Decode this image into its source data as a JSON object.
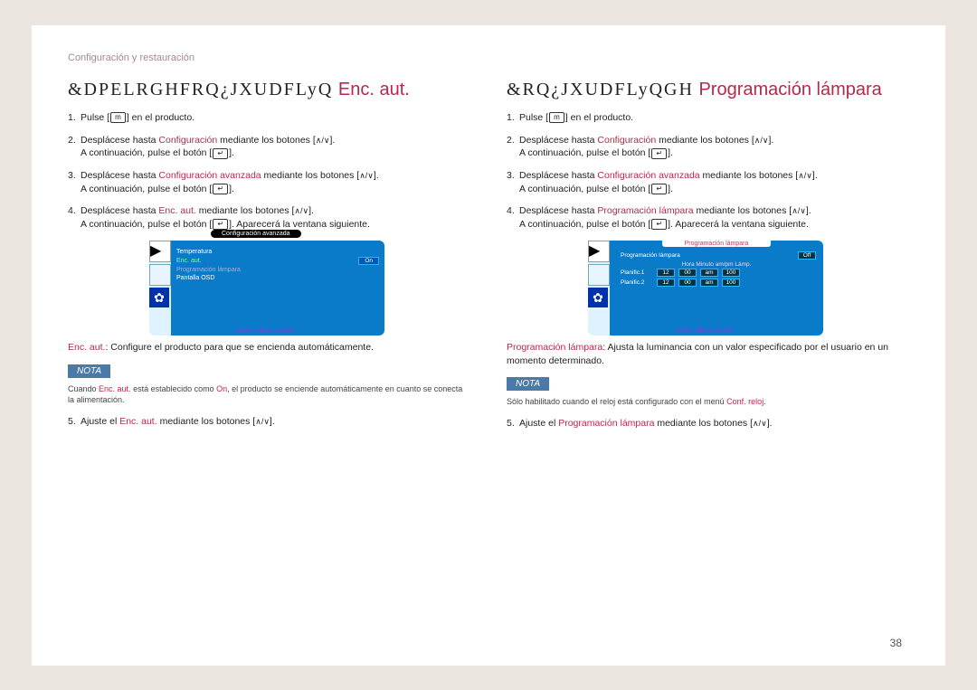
{
  "header": "Configuración y restauración",
  "pageNumber": "38",
  "left": {
    "title_garbled": "&DPELRGHFRQ¿JXUDFLyQ",
    "title_accent": "Enc. aut.",
    "steps": {
      "s1a": "Pulse [",
      "s1b": "] en el producto.",
      "s2a": "Desplácese hasta ",
      "s2b": "Configuración",
      "s2c": " mediante los botones [",
      "s2d": "].",
      "s2e": "A continuación, pulse el botón [",
      "s2f": "].",
      "s3a": "Desplácese hasta ",
      "s3b": "Configuración avanzada",
      "s3c": " mediante los botones [",
      "s3d": "].",
      "s3e": "A continuación, pulse el botón [",
      "s3f": "].",
      "s4a": "Desplácese hasta ",
      "s4b": "Enc. aut.",
      "s4c": " mediante los botones [",
      "s4d": "].",
      "s4e": "A continuación, pulse el botón [",
      "s4f": "]. Aparecerá la ventana siguiente.",
      "s5a": "Ajuste el ",
      "s5b": "Enc. aut.",
      "s5c": " mediante los botones [",
      "s5d": "]."
    },
    "osd": {
      "tab": "Configuración avanzada",
      "r1": "Temperatura",
      "r2": "Enc. aut.",
      "r2v": "On",
      "r3": "Programación lámpara",
      "r4": "Pantalla OSD",
      "legend": "↕Mover   ↵Entrar   ↺Volver"
    },
    "desc_hl": "Enc. aut.",
    "desc": ": Configure el producto para que se encienda automáticamente.",
    "nota_label": "NOTA",
    "nota_a": "Cuando ",
    "nota_b": "Enc. aut.",
    "nota_c": " está establecido como ",
    "nota_d": "On",
    "nota_e": ", el producto se enciende automáticamente en cuanto se conecta la alimentación."
  },
  "right": {
    "title_garbled": "&RQ¿JXUDFLyQGH",
    "title_accent": "Programación lámpara",
    "steps": {
      "s1a": "Pulse [",
      "s1b": "] en el producto.",
      "s2a": "Desplácese hasta ",
      "s2b": "Configuración",
      "s2c": " mediante los botones [",
      "s2d": "].",
      "s2e": "A continuación, pulse el botón [",
      "s2f": "].",
      "s3a": "Desplácese hasta ",
      "s3b": "Configuración avanzada",
      "s3c": " mediante los botones [",
      "s3d": "].",
      "s3e": "A continuación, pulse el botón [",
      "s3f": "].",
      "s4a": "Desplácese hasta ",
      "s4b": "Programación lámpara",
      "s4c": " mediante los botones [",
      "s4d": "].",
      "s4e": "A continuación, pulse el botón [",
      "s4f": "]. Aparecerá la ventana siguiente.",
      "s5a": "Ajuste el ",
      "s5b": "Programación lámpara",
      "s5c": " mediante los botones [",
      "s5d": "]."
    },
    "osd": {
      "tab": "Programación lámpara",
      "hdr": "Hora  Minuto  am/pm  Lámp.",
      "row0l": "Programación lámpara",
      "row0v": "Off",
      "r1k": "Planific.1",
      "r1a": "12",
      "r1b": "00",
      "r1c": "am",
      "r1d": "100",
      "r2k": "Planific.2",
      "r2a": "12",
      "r2b": "00",
      "r2c": "am",
      "r2d": "100",
      "legend": "↕Mover   ↵Entrar   ↺Volver"
    },
    "desc_hl": "Programación lámpara",
    "desc": ": Ajusta la luminancia con un valor especificado por el usuario en un momento determinado.",
    "nota_label": "NOTA",
    "nota_a": "Sólo habilitado cuando el reloj está configurado con el menú ",
    "nota_b": "Conf. reloj",
    "nota_c": "."
  },
  "icons": {
    "menu": "m",
    "updown": "∧/∨",
    "enter": "↵"
  }
}
